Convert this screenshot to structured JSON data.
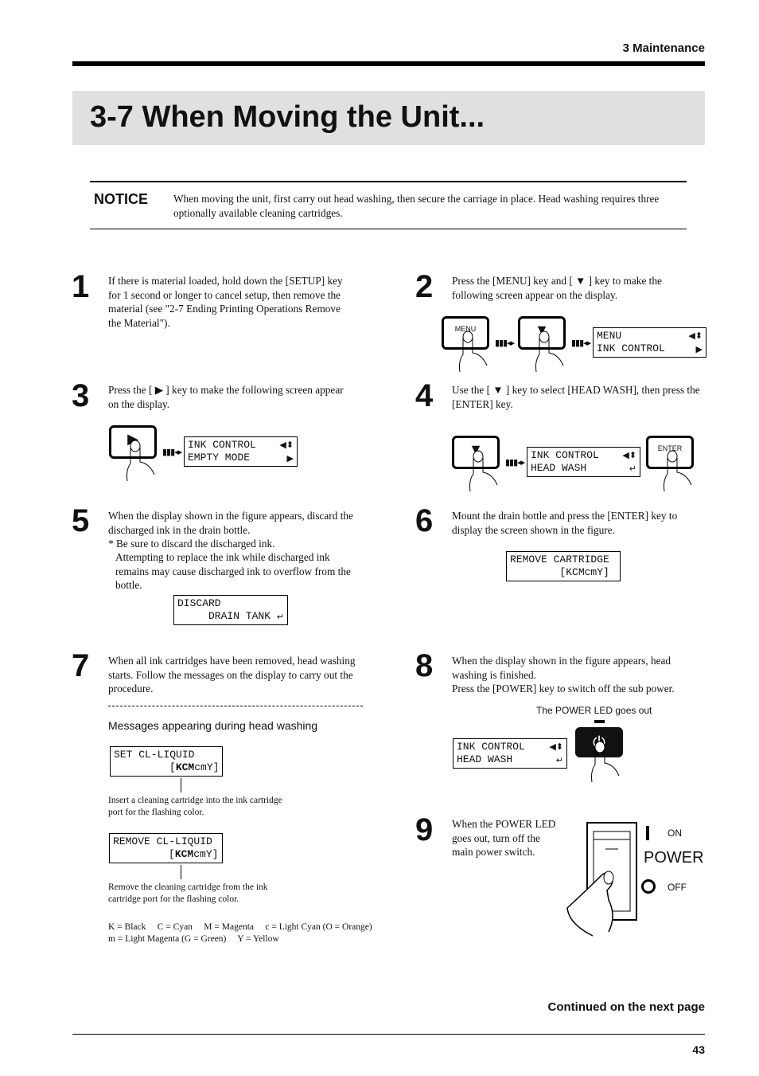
{
  "header": {
    "section": "3  Maintenance"
  },
  "title": "3-7  When Moving the Unit...",
  "notice": {
    "label": "NOTICE",
    "text": "When moving the unit, first carry out head washing, then secure the carriage in place.  Head washing requires three optionally available cleaning cartridges."
  },
  "steps": [
    {
      "num": "1",
      "text": "If there is material loaded, hold down the [SETUP] key for 1 second or longer to cancel setup, then remove the material (see \"2-7  Ending Printing Operations  Remove the Material\")."
    },
    {
      "num": "2",
      "text_a": "Press the [MENU] key and [ ",
      "text_b": " ] key to make the following screen appear on the display.",
      "key1": "MENU",
      "lcd": [
        "MENU",
        "INK CONTROL"
      ]
    },
    {
      "num": "3",
      "text_a": "Press the [ ",
      "text_b": " ] key to make the following screen appear on the display.",
      "lcd": [
        "INK CONTROL",
        "EMPTY MODE"
      ]
    },
    {
      "num": "4",
      "text_a": "Use the [ ",
      "text_b": " ] key to select [HEAD WASH], then press the [ENTER] key.",
      "lcd": [
        "INK CONTROL",
        "HEAD WASH"
      ],
      "key2": "ENTER"
    },
    {
      "num": "5",
      "lines": [
        "When the display shown in the figure appears, discard the discharged ink in the drain bottle.",
        "* Be sure to discard the discharged ink.",
        "Attempting to replace the ink while discharged ink remains may cause discharged ink to overflow from the bottle."
      ],
      "lcd": [
        "DISCARD",
        "     DRAIN TANK"
      ]
    },
    {
      "num": "6",
      "text": "Mount the drain bottle and press the [ENTER] key to display the screen shown in the figure.",
      "lcd": [
        "REMOVE CARTRIDGE",
        "        [KCMcmY]"
      ]
    },
    {
      "num": "7",
      "text": "When all ink cartridges have been removed, head washing starts.  Follow the messages on the display to carry out the procedure.",
      "subhead": "Messages appearing during head washing",
      "msg1": {
        "line1": "SET CL-LIQUID",
        "bold": "KCM",
        "rest": "cmY]",
        "caption": "Insert a cleaning cartridge into the ink cartridge port for the flashing color."
      },
      "msg2": {
        "line1": "REMOVE CL-LIQUID",
        "bold": "KCM",
        "rest": "cmY]",
        "caption": "Remove the cleaning cartridge from the ink cartridge port for the flashing color."
      },
      "legend1": "K = Black     C = Cyan     M = Magenta     c = Light Cyan (O = Orange)",
      "legend2": "m = Light Magenta (G = Green)     Y = Yellow"
    },
    {
      "num": "8",
      "lines": [
        "When the display shown in the figure appears, head washing is finished.",
        "Press the [POWER] key to switch off the sub power."
      ],
      "led_label": "The POWER LED goes out",
      "lcd": [
        "INK CONTROL",
        "HEAD WASH"
      ]
    },
    {
      "num": "9",
      "text": "When the POWER LED goes out, turn off the main power switch.",
      "on": "ON",
      "off": "OFF",
      "power": "POWER"
    }
  ],
  "footer": {
    "continued": "Continued on the next page",
    "page": "43"
  }
}
